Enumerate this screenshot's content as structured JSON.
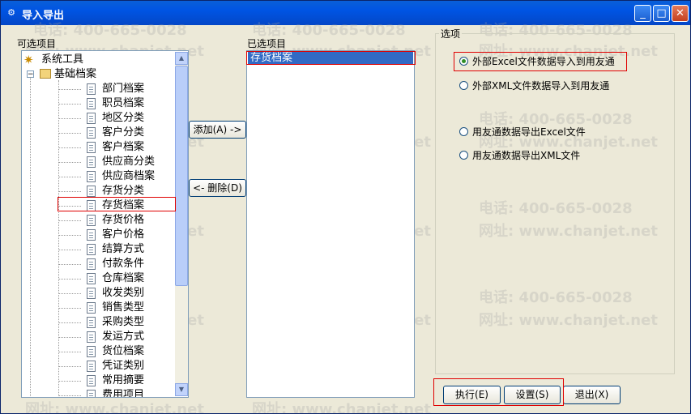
{
  "window": {
    "title": "导入导出",
    "minimize_glyph": "_",
    "maximize_glyph": "□",
    "close_glyph": "✕",
    "app_icon": "import-export-icon"
  },
  "available": {
    "label": "可选项目",
    "root": "系统工具",
    "folder": "基础档案",
    "items": [
      "部门档案",
      "职员档案",
      "地区分类",
      "客户分类",
      "客户档案",
      "供应商分类",
      "供应商档案",
      "存货分类",
      "存货档案",
      "存货价格",
      "客户价格",
      "结算方式",
      "付款条件",
      "仓库档案",
      "收发类别",
      "销售类型",
      "采购类型",
      "发运方式",
      "货位档案",
      "凭证类别",
      "常用摘要",
      "费用项目"
    ],
    "highlighted_item": "存货档案"
  },
  "transfer": {
    "add_label": "添加(A) ->",
    "remove_label": "<- 删除(D)"
  },
  "selected": {
    "label": "已选项目",
    "items": [
      "存货档案"
    ]
  },
  "options": {
    "label": "选项",
    "radios": [
      {
        "label": "外部Excel文件数据导入到用友通",
        "checked": true
      },
      {
        "label": "外部XML文件数据导入到用友通",
        "checked": false
      },
      {
        "label": "用友通数据导出Excel文件",
        "checked": false
      },
      {
        "label": "用友通数据导出XML文件",
        "checked": false
      }
    ]
  },
  "actions": {
    "execute_label": "执行(E)",
    "settings_label": "设置(S)",
    "exit_label": "退出(X)"
  },
  "watermark": {
    "phone": "电话: 400-665-0028",
    "site": "网址: www.chanjet.net"
  },
  "colors": {
    "title_bar": "#0054E3",
    "dialog_bg": "#ECE9D8",
    "selection": "#316AC5",
    "highlight_box": "#E00000"
  }
}
